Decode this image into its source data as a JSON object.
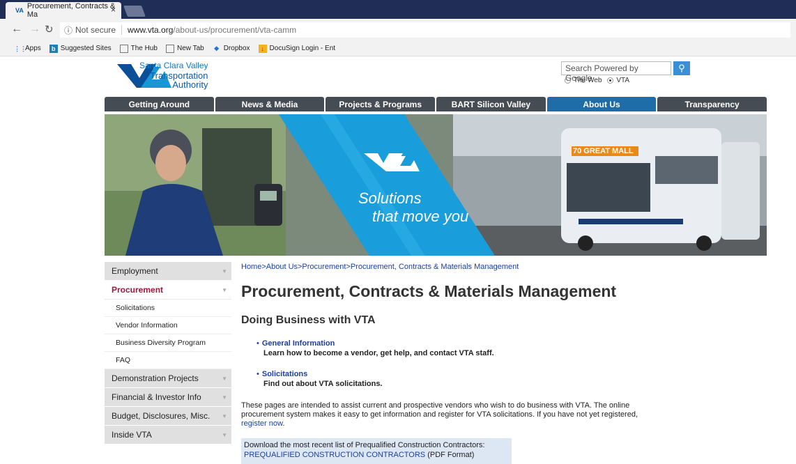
{
  "browser": {
    "tab_title": "Procurement, Contracts & Ma",
    "url_security": "Not secure",
    "url_domain": "www.vta.org",
    "url_path": "/about-us/procurement/vta-camm",
    "bookmarks": [
      "Apps",
      "Suggested Sites",
      "The Hub",
      "New Tab",
      "Dropbox",
      "DocuSign Login - Ent"
    ]
  },
  "header": {
    "logo_line1": "Santa Clara Valley",
    "logo_line2": "Transportation",
    "logo_line3": "Authority",
    "search_placeholder": "Search Powered by Google",
    "radio_web": "The Web",
    "radio_vta": "VTA"
  },
  "nav": [
    "Getting Around",
    "News & Media",
    "Projects & Programs",
    "BART Silicon Valley",
    "About Us",
    "Transparency"
  ],
  "hero": {
    "tagline1": "Solutions",
    "tagline2": "that move you",
    "bus_sign": "70 GREAT MALL"
  },
  "sidebar": {
    "items": [
      {
        "label": "Employment"
      },
      {
        "label": "Procurement"
      },
      {
        "label": "Solicitations"
      },
      {
        "label": "Vendor Information"
      },
      {
        "label": "Business Diversity Program"
      },
      {
        "label": "FAQ"
      },
      {
        "label": "Demonstration Projects"
      },
      {
        "label": "Financial & Investor Info"
      },
      {
        "label": "Budget, Disclosures, Misc."
      },
      {
        "label": "Inside VTA"
      }
    ]
  },
  "content": {
    "breadcrumb": "Home>About Us>Procurement>Procurement, Contracts & Materials Management",
    "title": "Procurement, Contracts & Materials Management",
    "subtitle": "Doing Business with VTA",
    "link1": "General Information",
    "link1_desc": "Learn how to become a vendor, get help, and contact VTA staff.",
    "link2": "Solicitations",
    "link2_desc": "Find out about VTA solicitations.",
    "para": "These pages are intended to assist current and prospective vendors who wish to do business with VTA. The online procurement system makes it easy to get information and register for VTA solicitations. If you have not yet registered, ",
    "para_link": "register now",
    "para_end": ".",
    "download_text": "Download the most recent list of Prequalified Construction Contractors:",
    "download_link": "PREQUALIFIED CONSTRUCTION CONTRACTORS",
    "download_suffix": " (PDF Format)"
  }
}
